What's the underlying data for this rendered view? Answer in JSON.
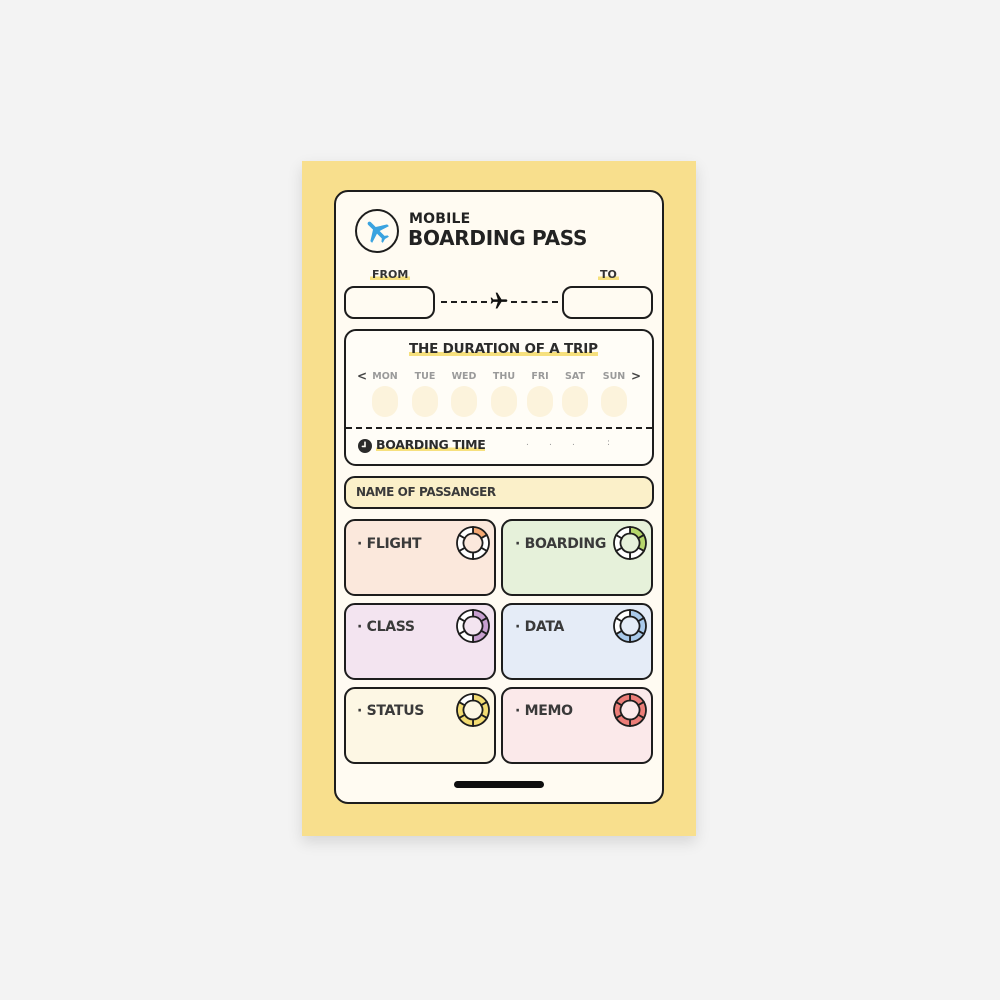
{
  "header": {
    "title_line1": "MOBILE",
    "title_line2": "BOARDING PASS",
    "logo_icon": "airplane-icon",
    "logo_color": "#3aa3e0"
  },
  "route": {
    "from_label": "FROM",
    "to_label": "TO",
    "from_value": "",
    "to_value": "",
    "divider_icon": "airplane-icon"
  },
  "duration": {
    "title": "THE DURATION OF A TRIP",
    "prev_label": "<",
    "next_label": ">",
    "days": [
      "MON",
      "TUE",
      "WED",
      "THU",
      "FRI",
      "SAT",
      "SUN"
    ],
    "boarding_time_label": "BOARDING TIME",
    "boarding_time_separators": [
      ".",
      ".",
      ".",
      ":"
    ]
  },
  "passenger": {
    "label": "NAME OF PASSANGER"
  },
  "tiles": [
    {
      "label": "· FLIGHT",
      "bg": "#fbe8dc",
      "accent": "#f4a974",
      "filled_segments": 1,
      "total_segments": 6
    },
    {
      "label": "· BOARDING",
      "bg": "#e6f1da",
      "accent": "#b5d66b",
      "filled_segments": 2,
      "total_segments": 6
    },
    {
      "label": "· CLASS",
      "bg": "#f3e4f0",
      "accent": "#c79fcf",
      "filled_segments": 3,
      "total_segments": 6
    },
    {
      "label": "· DATA",
      "bg": "#e5ecf7",
      "accent": "#a9c9ea",
      "filled_segments": 4,
      "total_segments": 6
    },
    {
      "label": "· STATUS",
      "bg": "#fdf7e4",
      "accent": "#f3dc72",
      "filled_segments": 5,
      "total_segments": 6
    },
    {
      "label": "· MEMO",
      "bg": "#fbe9ea",
      "accent": "#ec7d78",
      "filled_segments": 6,
      "total_segments": 6
    }
  ],
  "colors": {
    "outer_background": "#f8df8d",
    "screen_background": "#fffbf2",
    "highlight": "#f6e07d",
    "outline": "#1d1d1d"
  }
}
